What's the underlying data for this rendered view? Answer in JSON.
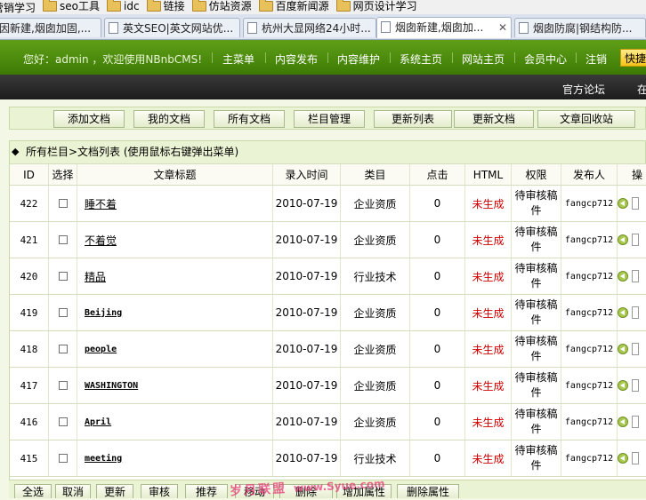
{
  "bookmarks": {
    "items": [
      {
        "label": "营销学习",
        "folder": false
      },
      {
        "label": "seo工具",
        "folder": true
      },
      {
        "label": "idc",
        "folder": true
      },
      {
        "label": "链接",
        "folder": true
      },
      {
        "label": "仿站资源",
        "folder": true
      },
      {
        "label": "百度新闻源",
        "folder": true
      },
      {
        "label": "网页设计学习",
        "folder": true
      }
    ]
  },
  "tabs": [
    {
      "label": "因新建,烟囱加固,..."
    },
    {
      "label": "英文SEO|英文网站优..."
    },
    {
      "label": "杭州大显网络24小时..."
    },
    {
      "label": "烟囱新建,烟囱加..."
    },
    {
      "label": "烟囱防腐|钢结构防..."
    }
  ],
  "nav": {
    "welcome": "您好：admin ，欢迎使用NBnbCMS!",
    "items": [
      "主菜单",
      "内容发布",
      "内容维护",
      "系统主页",
      "网站主页",
      "会员中心",
      "注销"
    ],
    "quick": "快捷"
  },
  "darkbar": {
    "forum": "官方论坛",
    "more": "在"
  },
  "toolbar": [
    "添加文档",
    "我的文档",
    "所有文档",
    "栏目管理",
    "更新列表",
    "更新文档",
    "文章回收站"
  ],
  "breadcrumb": {
    "diamond": "◆",
    "text": "所有栏目>文档列表  (使用鼠标右键弹出菜单)"
  },
  "table": {
    "headers": [
      "ID",
      "选择",
      "文章标题",
      "录入时间",
      "类目",
      "点击",
      "HTML",
      "权限",
      "发布人",
      "操"
    ],
    "rows": [
      {
        "id": "422",
        "title": "睡不着",
        "mono": false,
        "date": "2010-07-19",
        "category": "企业资质",
        "clicks": "0",
        "html": "未生成",
        "perm": "待审核稿件",
        "author": "fangcp712"
      },
      {
        "id": "421",
        "title": "不着觉",
        "mono": false,
        "date": "2010-07-19",
        "category": "企业资质",
        "clicks": "0",
        "html": "未生成",
        "perm": "待审核稿件",
        "author": "fangcp712"
      },
      {
        "id": "420",
        "title": "精品",
        "mono": false,
        "date": "2010-07-19",
        "category": "行业技术",
        "clicks": "0",
        "html": "未生成",
        "perm": "待审核稿件",
        "author": "fangcp712"
      },
      {
        "id": "419",
        "title": "Beijing",
        "mono": true,
        "date": "2010-07-19",
        "category": "企业资质",
        "clicks": "0",
        "html": "未生成",
        "perm": "待审核稿件",
        "author": "fangcp712"
      },
      {
        "id": "418",
        "title": "people",
        "mono": true,
        "date": "2010-07-19",
        "category": "企业资质",
        "clicks": "0",
        "html": "未生成",
        "perm": "待审核稿件",
        "author": "fangcp712"
      },
      {
        "id": "417",
        "title": "WASHINGTON",
        "mono": true,
        "date": "2010-07-19",
        "category": "企业资质",
        "clicks": "0",
        "html": "未生成",
        "perm": "待审核稿件",
        "author": "fangcp712"
      },
      {
        "id": "416",
        "title": "April",
        "mono": true,
        "date": "2010-07-19",
        "category": "企业资质",
        "clicks": "0",
        "html": "未生成",
        "perm": "待审核稿件",
        "author": "fangcp712"
      },
      {
        "id": "415",
        "title": "meeting",
        "mono": true,
        "date": "2010-07-19",
        "category": "行业技术",
        "clicks": "0",
        "html": "未生成",
        "perm": "待审核稿件",
        "author": "fangcp712"
      }
    ]
  },
  "actions": [
    "全选",
    "取消",
    "更新",
    "审核",
    "推荐",
    "移动",
    "删除",
    "增加属性",
    "删除属性"
  ],
  "watermark": {
    "text": "岁月联盟",
    "url": "www.Syue.com"
  },
  "colors": {
    "nav_green": "#4a8a0c",
    "status_red": "#d40000",
    "panel": "#eaf3d3"
  }
}
